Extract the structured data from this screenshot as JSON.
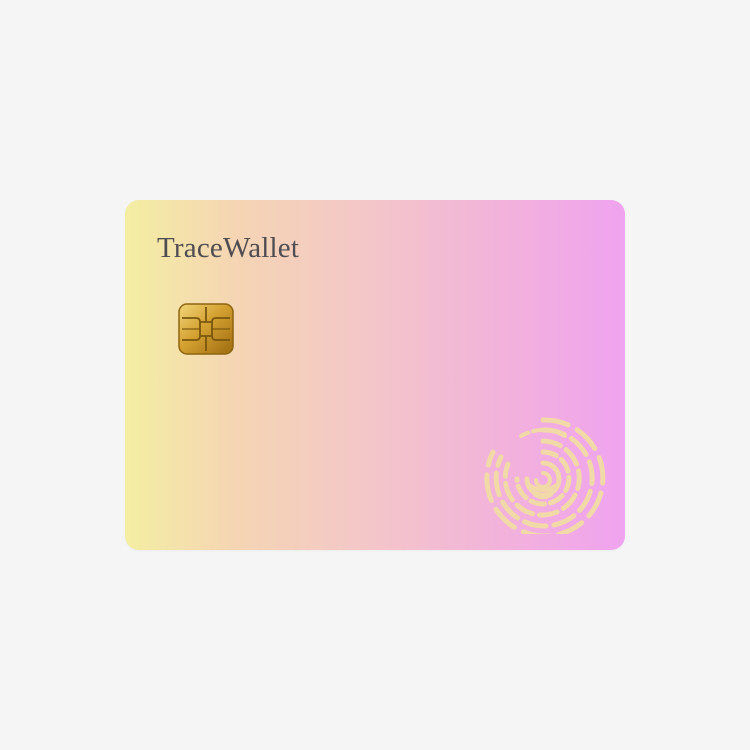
{
  "card": {
    "brand_name": "TraceWallet",
    "chip_icon": "emv-chip-icon",
    "fingerprint_icon": "fingerprint-icon"
  },
  "colors": {
    "background": "#f5f5f5",
    "gradient_start": "#f4eea2",
    "gradient_mid": "#f3c7c8",
    "gradient_end": "#f0a3ef",
    "brand_text": "#4f4d51",
    "chip_gold": "#d8aa35",
    "fingerprint": "#f1d9a8"
  }
}
